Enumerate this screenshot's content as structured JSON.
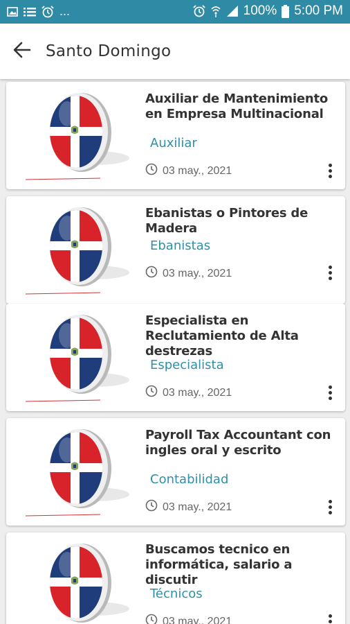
{
  "status_bar": {
    "left_icons": [
      "image-icon",
      "list-icon",
      "alarm-icon"
    ],
    "overflow": "...",
    "right_icons": [
      "alarm-icon",
      "wifi-icon",
      "signal-icon"
    ],
    "battery": "100%",
    "time": "5:00 PM"
  },
  "app_bar": {
    "title": "Santo Domingo",
    "back_icon": "arrow-left-icon"
  },
  "colors": {
    "status_bar": "#2f8aa5",
    "accent": "#2e8faa",
    "flag_blue": "#1f3d7a",
    "flag_red": "#d8232a"
  },
  "jobs": [
    {
      "title": "Auxiliar de Mantenimiento en Empresa Multinacional",
      "category": "Auxiliar",
      "date": "03 may., 2021"
    },
    {
      "title": "Ebanistas o Pintores de Madera",
      "category": "Ebanistas",
      "date": "03 may., 2021"
    },
    {
      "title": "Especialista en Reclutamiento de Alta destrezas",
      "category": "Especialista",
      "date": "03 may., 2021"
    },
    {
      "title": "Payroll Tax Accountant con ingles oral y escrito",
      "category": "Contabilidad",
      "date": "03 may., 2021"
    },
    {
      "title": "Buscamos tecnico en informática, salario a discutir",
      "category": "Técnicos",
      "date": "03 may., 2021"
    }
  ]
}
